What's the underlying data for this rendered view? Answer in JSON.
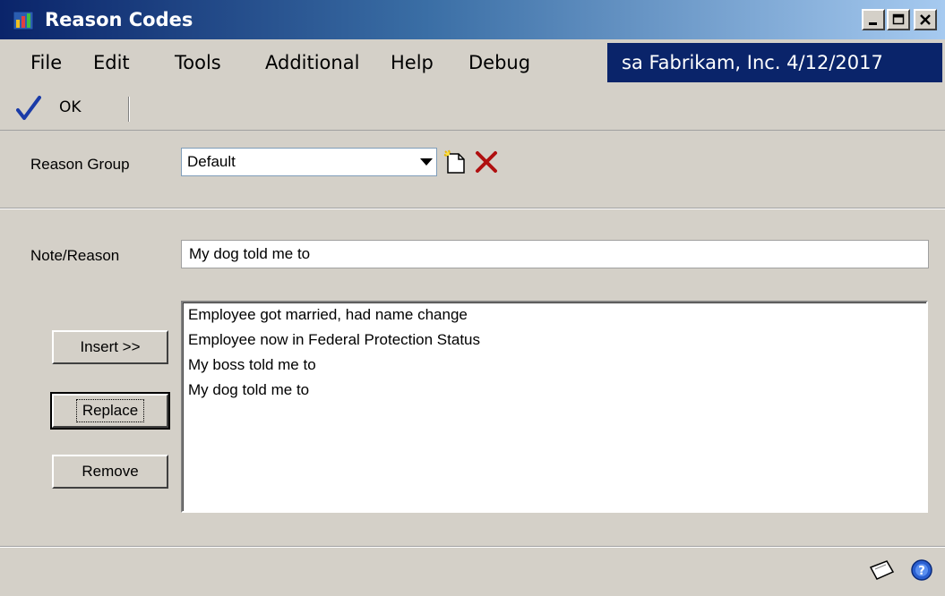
{
  "window": {
    "title": "Reason Codes"
  },
  "menu": {
    "items": [
      "File",
      "Edit",
      "Tools",
      "Additional",
      "Help",
      "Debug"
    ],
    "company_info": "sa Fabrikam, Inc. 4/12/2017"
  },
  "toolbar": {
    "ok_label": "OK"
  },
  "form": {
    "reason_group_label": "Reason Group",
    "reason_group_value": "Default",
    "note_reason_label": "Note/Reason",
    "note_reason_value": "My dog told me to"
  },
  "buttons": {
    "insert": "Insert >>",
    "replace": "Replace",
    "remove": "Remove"
  },
  "list": {
    "items": [
      "Employee got married, had name change",
      "Employee now in Federal Protection Status",
      "My boss told me to",
      "My dog told me to"
    ]
  },
  "icons": {
    "app": "reason-codes-app-icon",
    "new": "new-document-icon",
    "delete": "delete-x-icon",
    "note": "note-icon",
    "help": "help-icon"
  },
  "colors": {
    "title_gradient_start": "#0a246a",
    "title_gradient_end": "#a6caf0",
    "company_bg": "#0a246a",
    "window_bg": "#d4d0c8",
    "ok_check": "#1a3ba8",
    "delete_x": "#b01010"
  }
}
